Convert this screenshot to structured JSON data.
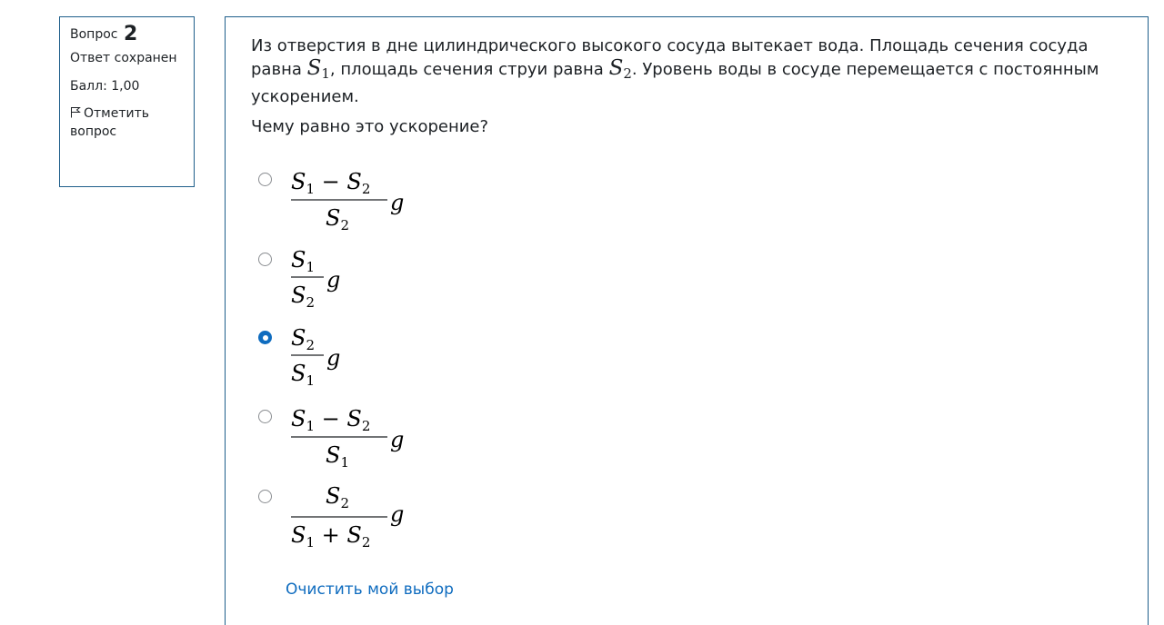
{
  "info": {
    "question_label": "Вопрос",
    "question_number": "2",
    "state": "Ответ сохранен",
    "grade": "Балл: 1,00",
    "flag_label": "Отметить вопрос"
  },
  "question": {
    "text_part1": "Из отверстия в дне цилиндрического высокого сосуда вытекает вода. Площадь сечения сосуда равна ",
    "symbol_1": "S",
    "sub_1": "1",
    "text_part2": ", площадь сечения струи равна ",
    "symbol_2": "S",
    "sub_2": "2",
    "text_part3": ". Уровень воды в сосуде перемещается с постоянным ускорением.",
    "prompt": "Чему равно это ускорение?"
  },
  "answers": [
    {
      "numerator": "S₁ − S₂",
      "denominator": "S₂",
      "factor": "g",
      "selected": false
    },
    {
      "numerator": "S₁",
      "denominator": "S₂",
      "factor": "g",
      "selected": false
    },
    {
      "numerator": "S₂",
      "denominator": "S₁",
      "factor": "g",
      "selected": true
    },
    {
      "numerator": "S₁ − S₂",
      "denominator": "S₁",
      "factor": "g",
      "selected": false
    },
    {
      "numerator": "S₂",
      "denominator": "S₁ + S₂",
      "factor": "g",
      "selected": false
    }
  ],
  "clear_choice_label": "Очистить мой выбор",
  "colors": {
    "border": "#1f5f8b",
    "accent": "#0f6cbf",
    "text": "#1d2125"
  }
}
